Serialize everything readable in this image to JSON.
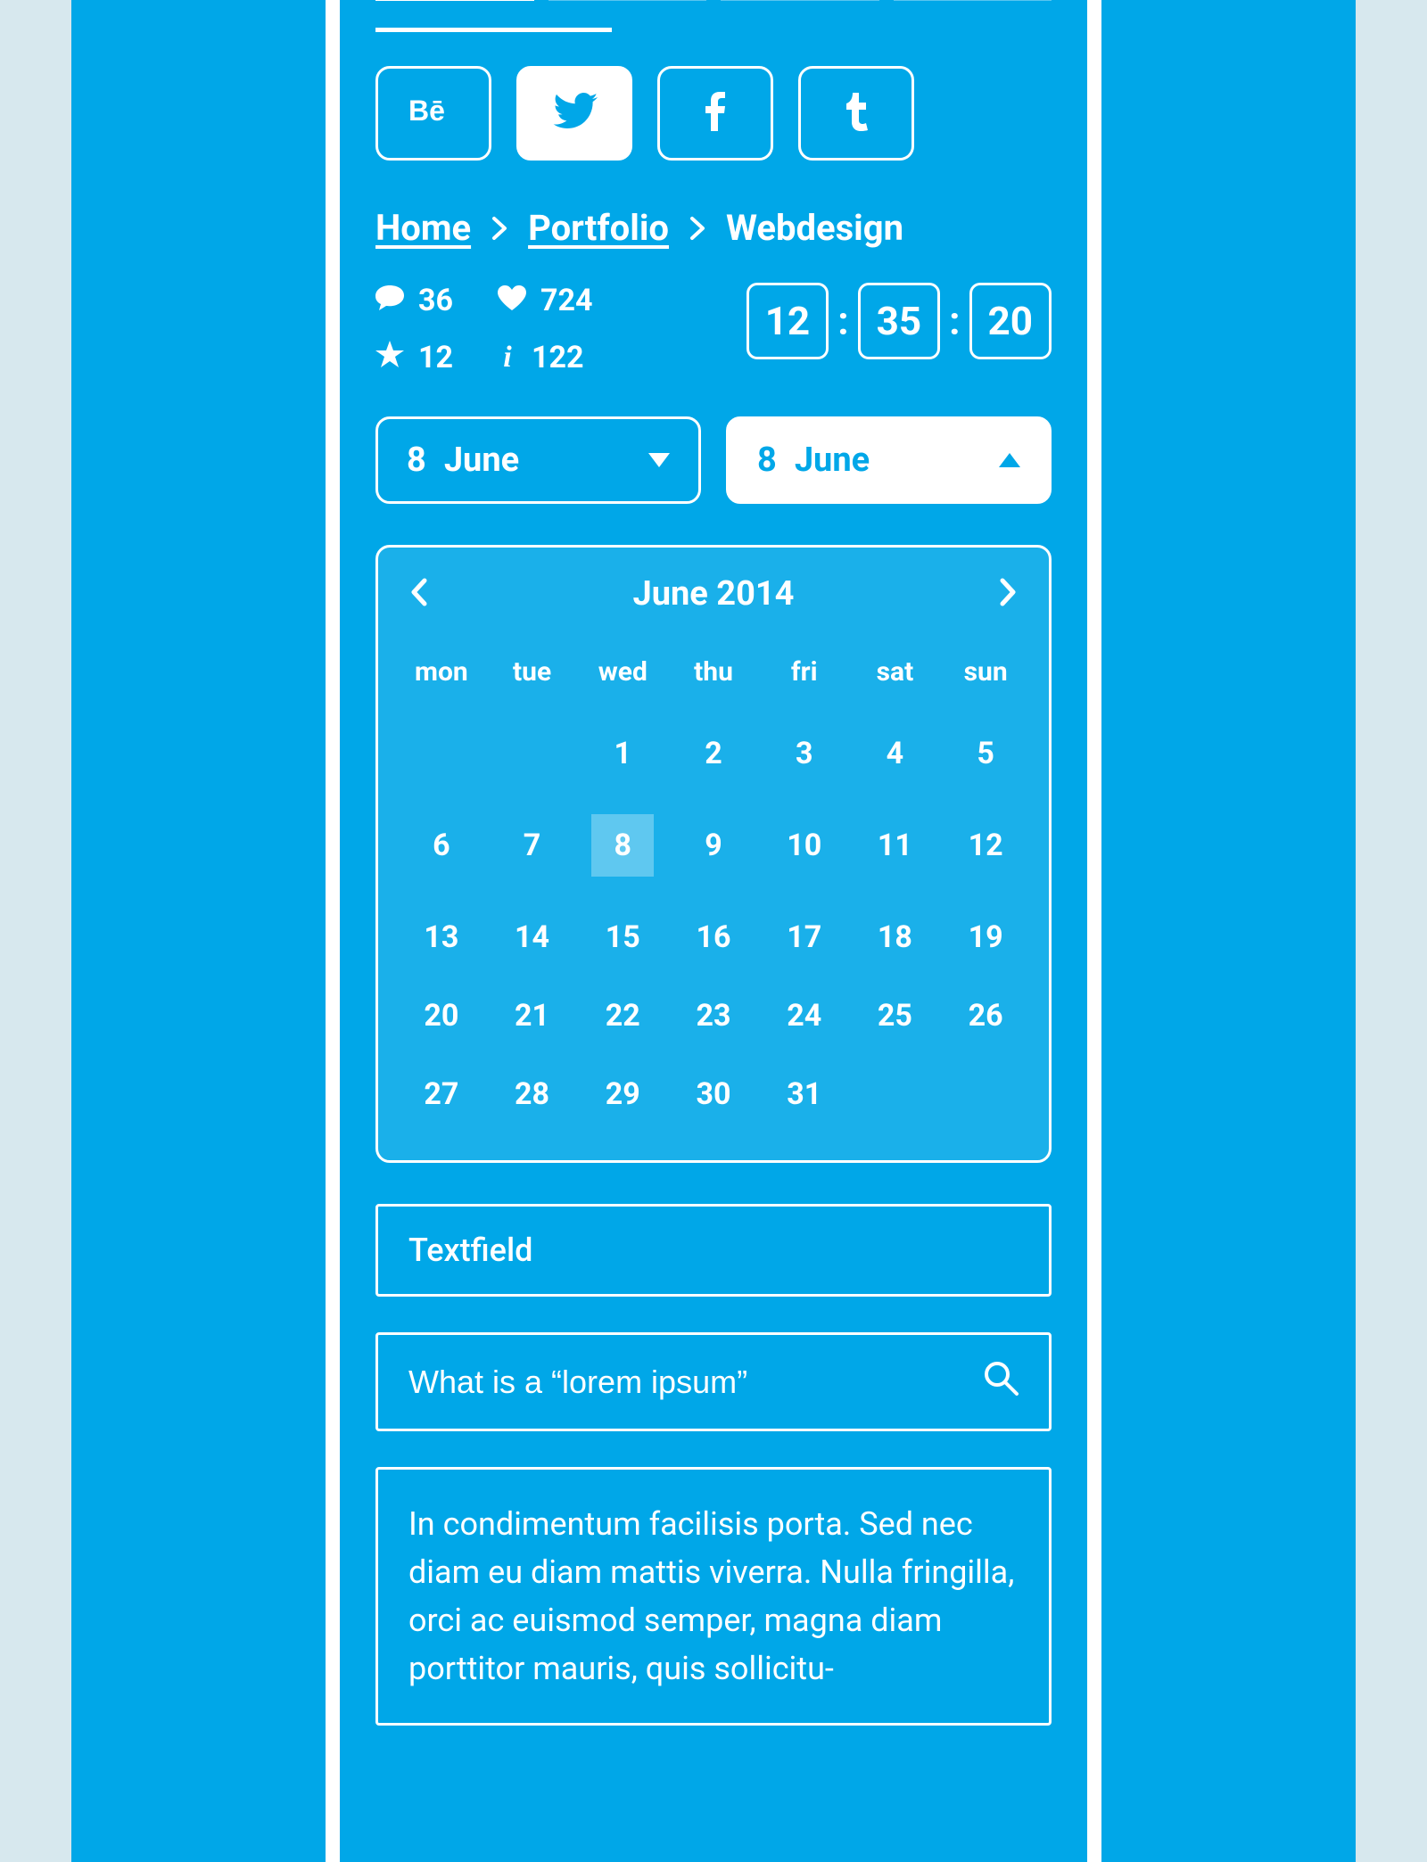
{
  "colors": {
    "brand": "#00a7e8",
    "fg": "#ffffff",
    "page_bg": "#d7e8ee"
  },
  "progress": {
    "segments": 4,
    "active_index": 0
  },
  "social": [
    {
      "icon": "behance",
      "active": false
    },
    {
      "icon": "twitter",
      "active": true
    },
    {
      "icon": "facebook",
      "active": false
    },
    {
      "icon": "tumblr",
      "active": false
    }
  ],
  "breadcrumb": {
    "home": "Home",
    "portfolio": "Portfolio",
    "current": "Webdesign"
  },
  "stats": {
    "comments": "36",
    "likes": "724",
    "stars": "12",
    "info": "122"
  },
  "clock": {
    "h": "12",
    "m": "35",
    "s": "20"
  },
  "date_picker_closed": {
    "label_day": "8",
    "label_month": "June"
  },
  "date_picker_open": {
    "label_day": "8",
    "label_month": "June"
  },
  "calendar": {
    "title": "June 2014",
    "dow": [
      "mon",
      "tue",
      "wed",
      "thu",
      "fri",
      "sat",
      "sun"
    ],
    "leading_blanks": 2,
    "days": 31,
    "selected": 8
  },
  "textfield_placeholder": "Textfield",
  "search_placeholder": "What is a “lorem ipsum”",
  "paragraph": "In condimentum facilisis porta. Sed nec diam eu diam mattis viverra. Nulla fringilla, orci ac euismod semper, magna diam porttitor mauris, quis sollicitu-"
}
